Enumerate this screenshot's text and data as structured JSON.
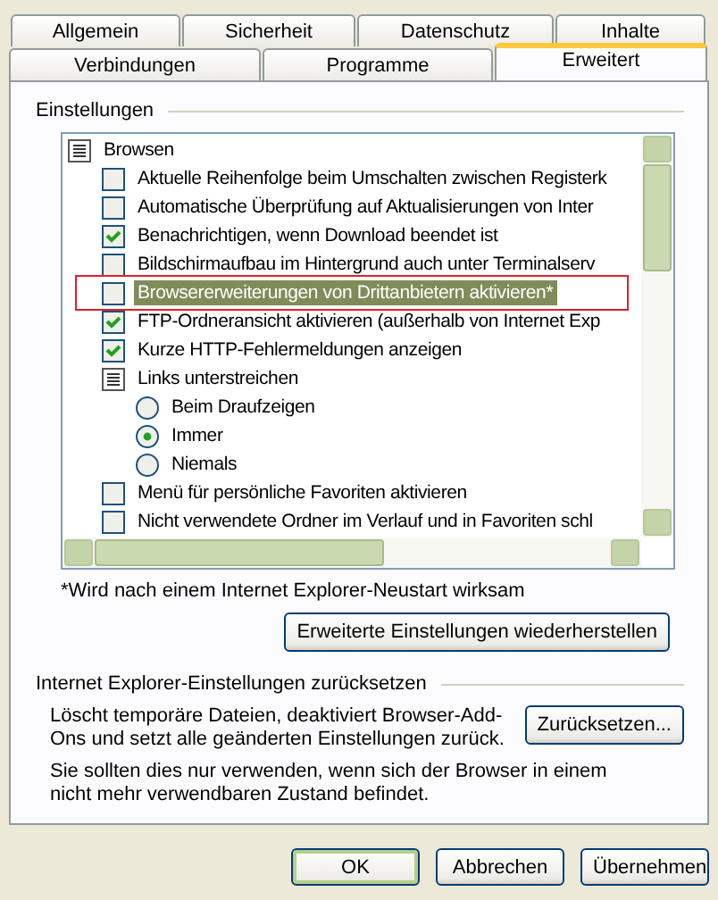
{
  "tabs_row_1": [
    {
      "label": "Allgemein",
      "selected": false
    },
    {
      "label": "Sicherheit",
      "selected": false
    },
    {
      "label": "Datenschutz",
      "selected": false
    },
    {
      "label": "Inhalte",
      "selected": false
    }
  ],
  "tabs_row_2": [
    {
      "label": "Verbindungen",
      "selected": false
    },
    {
      "label": "Programme",
      "selected": false
    },
    {
      "label": "Erweitert",
      "selected": true
    }
  ],
  "settings": {
    "title": "Einstellungen",
    "items": [
      {
        "kind": "folder",
        "label": "Browsen",
        "children": [
          {
            "kind": "checkbox",
            "label": "Aktuelle Reihenfolge beim Umschalten zwischen Registerk",
            "checked": false,
            "selected": false,
            "marked": false
          },
          {
            "kind": "checkbox",
            "label": "Automatische Überprüfung auf Aktualisierungen von Inter",
            "checked": false,
            "selected": false,
            "marked": false
          },
          {
            "kind": "checkbox",
            "label": "Benachrichtigen, wenn Download beendet ist",
            "checked": true,
            "selected": false,
            "marked": false
          },
          {
            "kind": "checkbox",
            "label": "Bildschirmaufbau im Hintergrund auch unter Terminalserv",
            "checked": false,
            "selected": false,
            "marked": false
          },
          {
            "kind": "checkbox",
            "label": "Browsererweiterungen von Drittanbietern aktivieren*",
            "checked": false,
            "selected": true,
            "marked": true
          },
          {
            "kind": "checkbox",
            "label": "FTP-Ordneransicht aktivieren (außerhalb von Internet Exp",
            "checked": true,
            "selected": false,
            "marked": false
          },
          {
            "kind": "checkbox",
            "label": "Kurze HTTP-Fehlermeldungen anzeigen",
            "checked": true,
            "selected": false,
            "marked": false
          },
          {
            "kind": "folder",
            "label": "Links unterstreichen",
            "children": [
              {
                "kind": "radio",
                "label": "Beim Draufzeigen",
                "selected": false
              },
              {
                "kind": "radio",
                "label": "Immer",
                "selected": true
              },
              {
                "kind": "radio",
                "label": "Niemals",
                "selected": false
              }
            ]
          },
          {
            "kind": "checkbox",
            "label": "Menü für persönliche Favoriten aktivieren",
            "checked": false,
            "selected": false,
            "marked": false
          },
          {
            "kind": "checkbox",
            "label": "Nicht verwendete Ordner im Verlauf und in Favoriten schl",
            "checked": false,
            "selected": false,
            "marked": false
          }
        ]
      }
    ],
    "footnote": "*Wird nach einem Internet Explorer-Neustart wirksam",
    "restore_button": "Erweiterte Einstellungen wiederherstellen"
  },
  "reset": {
    "title": "Internet Explorer-Einstellungen zurücksetzen",
    "description": "Löscht temporäre Dateien, deaktiviert Browser-Add-Ons und setzt alle geänderten Einstellungen zurück.",
    "button": "Zurücksetzen...",
    "note": "Sie sollten dies nur verwenden, wenn sich der Browser in einem nicht mehr verwendbaren Zustand befindet."
  },
  "buttons": [
    {
      "label": "OK",
      "default": true
    },
    {
      "label": "Abbrechen",
      "default": false
    },
    {
      "label": "Übernehmen",
      "default": false
    }
  ]
}
